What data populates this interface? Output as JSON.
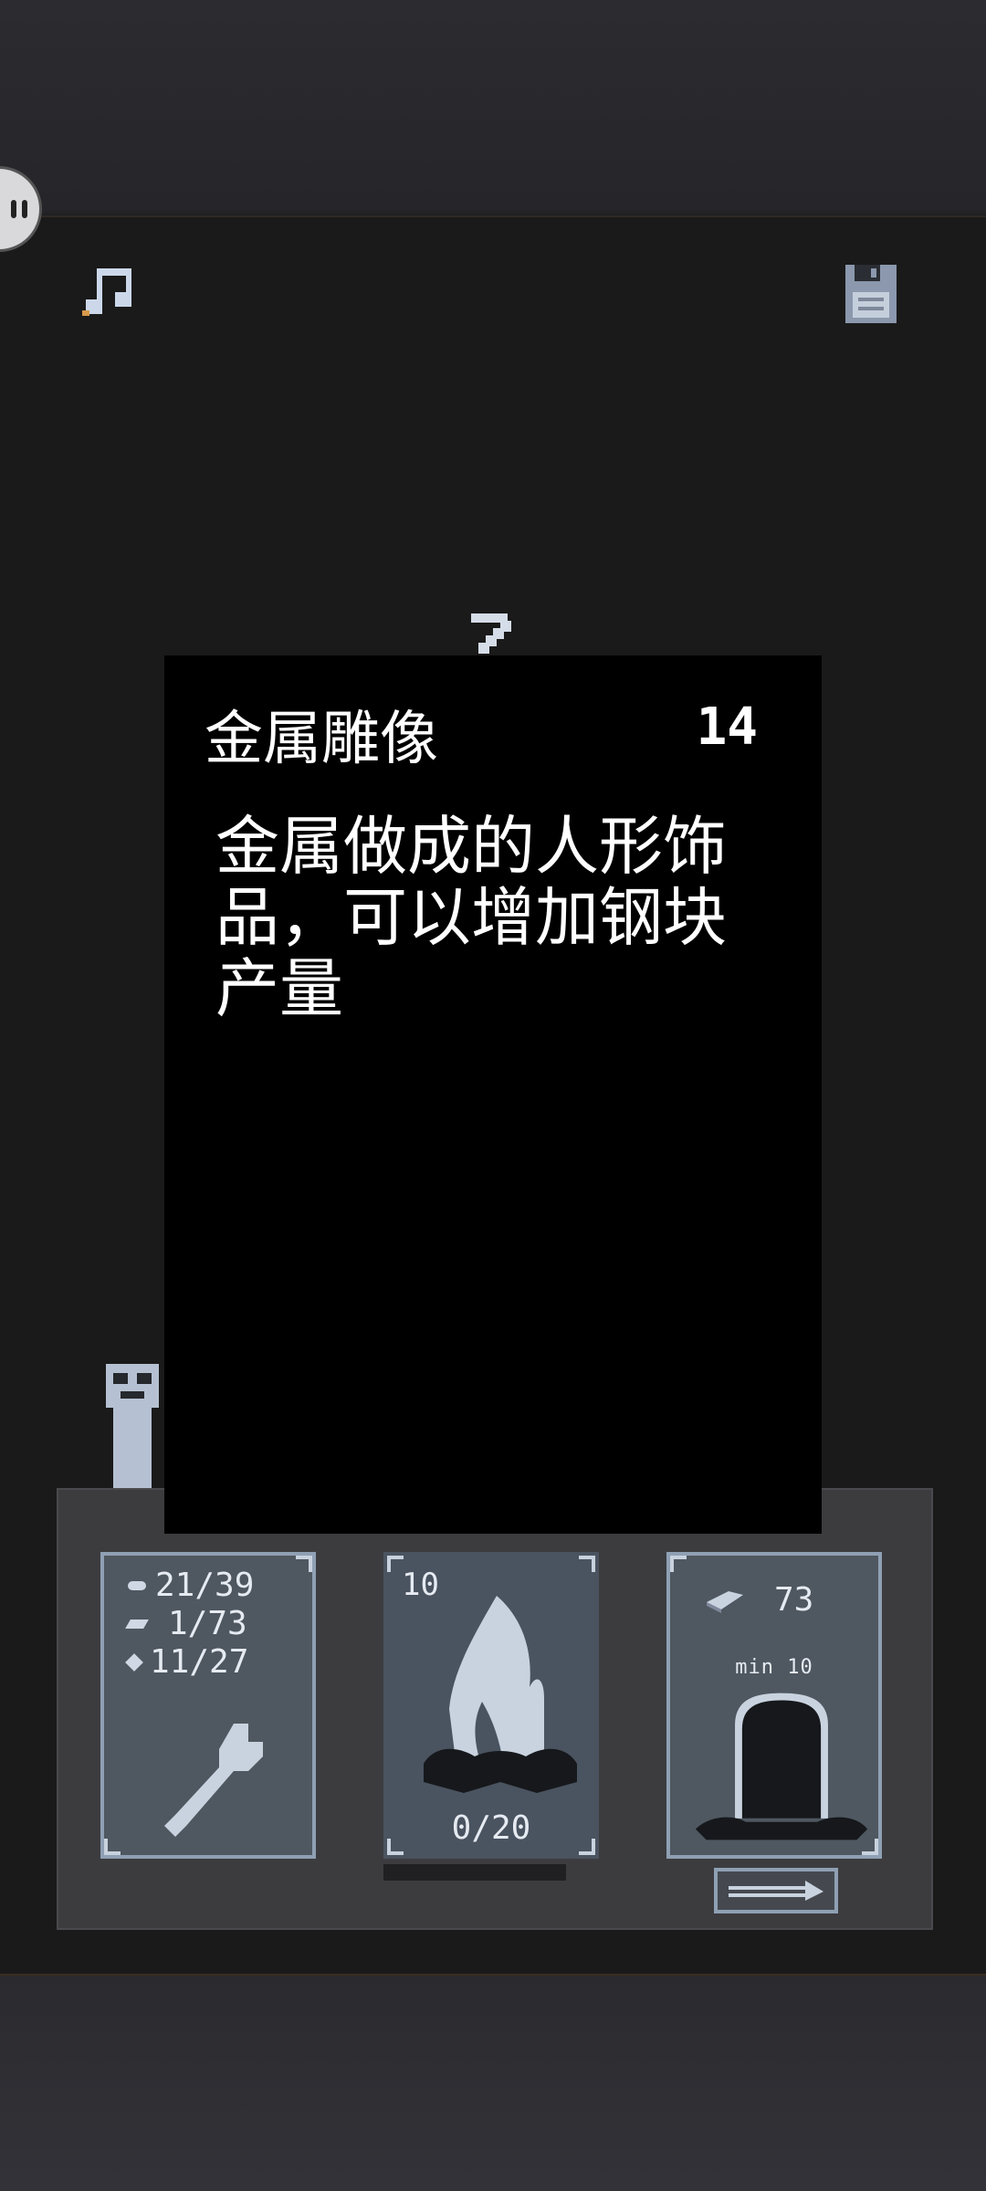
{
  "top_bar": {
    "music_icon": "music-note-icon",
    "save_icon": "floppy-disk-icon"
  },
  "tooltip": {
    "title": "金属雕像",
    "count": "14",
    "description": "金属做成的人形饰品，可以增加钢块产量"
  },
  "cards": {
    "craft": {
      "resources": [
        {
          "icon": "stone-icon",
          "value": "21/39"
        },
        {
          "icon": "ingot-icon",
          "value": "1/73"
        },
        {
          "icon": "gem-icon",
          "value": "11/27"
        }
      ],
      "icon": "wrench-icon"
    },
    "fire": {
      "level": "10",
      "progress": "0/20",
      "icon": "campfire-icon"
    },
    "build": {
      "ingots": "73",
      "min_label": "min 10",
      "icon": "portal-icon"
    }
  },
  "colors": {
    "card_fill": "#4f5760",
    "card_border": "#8fa0b4",
    "tooltip_bg": "#000000",
    "text": "#ffffff"
  }
}
